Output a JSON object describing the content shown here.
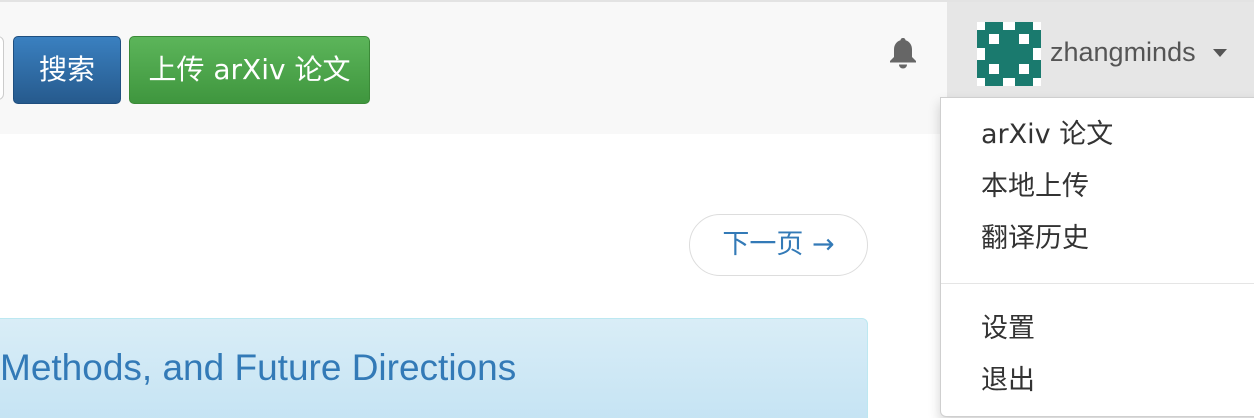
{
  "navbar": {
    "search_button": "搜索",
    "upload_button": "上传 arXiv 论文",
    "notification_icon": "bell-icon",
    "user": {
      "username": "zhangminds",
      "avatar_colors": [
        "#1a7a6e",
        "#ffffff"
      ]
    }
  },
  "user_menu": {
    "items": [
      {
        "label": "arXiv 论文"
      },
      {
        "label": "本地上传"
      },
      {
        "label": "翻译历史"
      },
      {
        "label": "设置"
      },
      {
        "label": "退出"
      }
    ]
  },
  "pager": {
    "next_label": "下一页 →"
  },
  "paper": {
    "title_fragment": "Methods, and Future Directions"
  },
  "colors": {
    "primary": "#337ab7",
    "search_button": "#2e6da4",
    "upload_button": "#4cae4c",
    "panel_info": "#d9edf7"
  }
}
